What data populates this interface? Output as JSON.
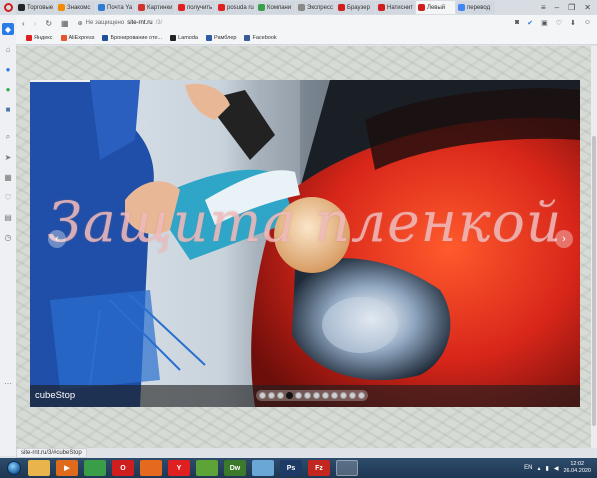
{
  "browser": {
    "tabs": [
      {
        "label": "Торговые",
        "color": "#222"
      },
      {
        "label": "Знакомс",
        "color": "#f28b00"
      },
      {
        "label": "Почта Ya",
        "color": "#2e7bd6"
      },
      {
        "label": "Картинки",
        "color": "#d0342c"
      },
      {
        "label": "получить",
        "color": "#e02020"
      },
      {
        "label": "posuda ru",
        "color": "#e02020"
      },
      {
        "label": "Компани",
        "color": "#3aa04a"
      },
      {
        "label": "Экспресс",
        "color": "#888"
      },
      {
        "label": "Браузер",
        "color": "#d01d1d"
      },
      {
        "label": "Натиснит",
        "color": "#d01d1d"
      },
      {
        "label": "Левый",
        "color": "#d01d1d"
      },
      {
        "label": "перевод",
        "color": "#4285f4"
      }
    ],
    "active_tab_index": 10,
    "address": {
      "security": "Не защищено",
      "host": "site-rnt.ru",
      "path": "/3/"
    },
    "bookmarks": [
      {
        "label": "Яндекс",
        "color": "#e02020"
      },
      {
        "label": "AliExpress",
        "color": "#e8542c"
      },
      {
        "label": "Бронирование оте...",
        "color": "#1d4f9c"
      },
      {
        "label": "Lamoda",
        "color": "#222"
      },
      {
        "label": "Рамблер",
        "color": "#2e5aa8"
      },
      {
        "label": "Facebook",
        "color": "#3b5998"
      }
    ]
  },
  "slider": {
    "title": "Защита пленкой",
    "caption": "cubeStop",
    "bullet_count": 12,
    "active_bullet": 3,
    "prev_label": "‹",
    "next_label": "›"
  },
  "status_url": "site-rnt.ru/3/#cubeStop",
  "taskbar": {
    "apps": [
      {
        "name": "explorer-app",
        "label": "",
        "color": "#e9b44c"
      },
      {
        "name": "media-player-app",
        "label": "▶",
        "color": "#e06a1b"
      },
      {
        "name": "chrome-app",
        "label": "",
        "color": "#3a9d48"
      },
      {
        "name": "opera-app",
        "label": "O",
        "color": "#d01d1d"
      },
      {
        "name": "firefox-app",
        "label": "",
        "color": "#e66a1d"
      },
      {
        "name": "yandex-browser-app",
        "label": "Y",
        "color": "#e02020"
      },
      {
        "name": "utorrent-app",
        "label": "",
        "color": "#5da338"
      },
      {
        "name": "dreamweaver-app",
        "label": "Dw",
        "color": "#3a7a2a"
      },
      {
        "name": "paint-app",
        "label": "",
        "color": "#6aa7d6"
      },
      {
        "name": "photoshop-app",
        "label": "Ps",
        "color": "#1e3a66"
      },
      {
        "name": "filezilla-app",
        "label": "Fz",
        "color": "#c2261f"
      },
      {
        "name": "window-app",
        "label": "",
        "color": "#6a8fb8"
      }
    ],
    "active_app": 11,
    "language": "EN",
    "time": "12:02",
    "date": "26.04.2020"
  }
}
